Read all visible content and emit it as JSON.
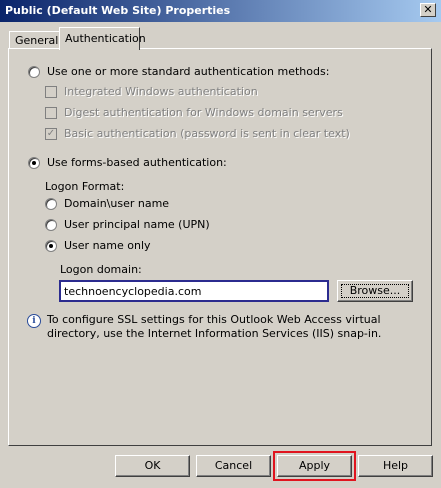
{
  "window": {
    "title": "Public (Default Web Site) Properties",
    "close_glyph": "✕"
  },
  "tabs": [
    {
      "label": "General",
      "selected": false
    },
    {
      "label": "Authentication",
      "selected": true
    }
  ],
  "auth": {
    "standard_methods": {
      "label": "Use one or more standard authentication methods:",
      "checked": false
    },
    "integrated": {
      "label": "Integrated Windows authentication",
      "checked": false,
      "enabled": false
    },
    "digest": {
      "label": "Digest authentication for Windows domain servers",
      "checked": false,
      "enabled": false
    },
    "basic": {
      "label": "Basic authentication (password is sent in clear text)",
      "checked": true,
      "enabled": false
    },
    "forms_based": {
      "label": "Use forms-based authentication:",
      "checked": true
    },
    "logon_format_label": "Logon Format:",
    "domain_user": {
      "label": "Domain\\user name",
      "checked": false
    },
    "upn": {
      "label": "User principal name (UPN)",
      "checked": false
    },
    "username_only": {
      "label": "User name only",
      "checked": true
    },
    "logon_domain_label": "Logon domain:",
    "logon_domain_value": "technoencyclopedia.com",
    "browse_label": "Browse...",
    "info_text": "To configure SSL settings for this Outlook Web Access virtual directory, use the Internet Information Services (IIS) snap-in."
  },
  "buttons": {
    "ok": "OK",
    "cancel": "Cancel",
    "apply": "Apply",
    "help": "Help"
  },
  "colors": {
    "titlebar_start": "#0a246a",
    "titlebar_end": "#a6caf0",
    "highlight_blue": "#2b2b8f",
    "highlight_red": "#e0141e",
    "face": "#d4d0c8"
  }
}
